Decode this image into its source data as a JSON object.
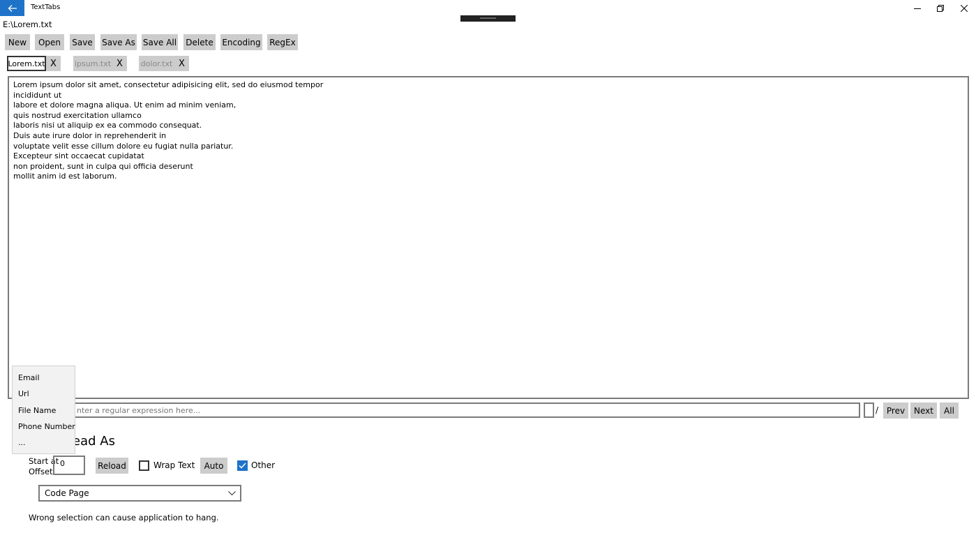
{
  "window": {
    "title": "TextTabs",
    "path": "E:\\Lorem.txt"
  },
  "toolbar": {
    "new": "New",
    "open": "Open",
    "save": "Save",
    "save_as": "Save As",
    "save_all": "Save All",
    "delete": "Delete",
    "encoding": "Encoding",
    "regex": "RegEx"
  },
  "tabs": [
    {
      "label": "Lorem.txt",
      "close": "X",
      "active": true
    },
    {
      "label": "ipsum.txt",
      "close": "X",
      "active": false
    },
    {
      "label": "dolor.txt",
      "close": "X",
      "active": false
    }
  ],
  "editor": {
    "lines": [
      "Lorem ipsum dolor sit amet, consectetur adipisicing elit, sed do eiusmod tempor",
      "incididunt ut",
      "labore et dolore magna aliqua. Ut enim ad minim veniam,",
      "quis nostrud exercitation ullamco",
      "laboris nisi ut aliquip ex ea commodo consequat.",
      "Duis aute irure dolor in reprehenderit in",
      "voluptate velit esse cillum dolore eu fugiat nulla pariatur.",
      "Excepteur sint occaecat cupidatat",
      "non proident, sunt in culpa qui officia deserunt",
      "mollit anim id est laborum."
    ]
  },
  "regex": {
    "placeholder": "nter a regular expression here...",
    "slash": "/",
    "prev": "Prev",
    "next": "Next",
    "all": "All"
  },
  "popup": {
    "items": [
      "Email",
      "Url",
      "File Name",
      "Phone Number",
      "..."
    ]
  },
  "read_as": {
    "heading": "ead As",
    "offset_label_1": "Start at",
    "offset_label_2": "Offset:",
    "offset_value": "0",
    "reload": "Reload",
    "wrap_text": "Wrap Text",
    "wrap_checked": false,
    "auto": "Auto",
    "other": "Other",
    "other_checked": true,
    "code_page": "Code Page",
    "warning": "Wrong selection can cause application to hang."
  },
  "colors": {
    "accent": "#1e73c9",
    "button_bg": "#cccccc",
    "check_blue": "#1e73c9"
  }
}
